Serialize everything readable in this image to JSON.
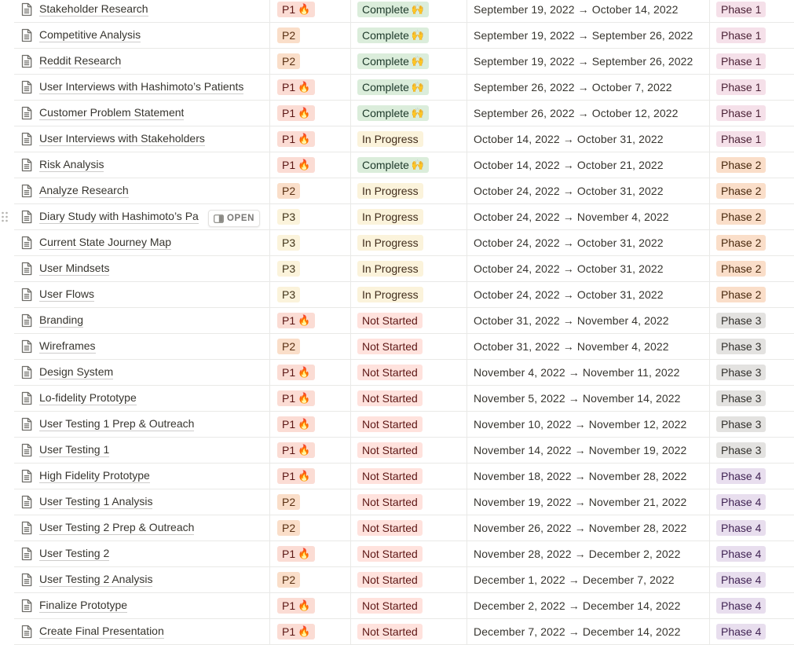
{
  "colors": {
    "p1": "#fbdcd4",
    "p1_text": "#5d1715",
    "p2": "#fadec9",
    "p2_text": "#5b3113",
    "p3": "#fbf3db",
    "p3_text": "#42351a",
    "complete": "#dbeddb",
    "complete_text": "#1c3829",
    "in_progress": "#fbf3db",
    "in_progress_text": "#402c1b",
    "not_started": "#ffe2dd",
    "not_started_text": "#5d1715",
    "phase_1": "#f5e0e9",
    "phase_1_text": "#4c2337",
    "phase_2": "#fadec9",
    "phase_2_text": "#49290e",
    "phase_3": "#e3e2e0",
    "phase_3_text": "#32302c",
    "phase_4": "#e8deee",
    "phase_4_text": "#412454"
  },
  "open_button": {
    "label": "OPEN",
    "row_index": 8,
    "icon": "sidepeek-icon"
  },
  "rows": [
    {
      "name": "Stakeholder Research",
      "priority": "P1",
      "priority_emoji": "🔥",
      "status": "Complete",
      "status_emoji": "🙌",
      "dates": "September 19, 2022 → October 14, 2022",
      "phase": "Phase 1"
    },
    {
      "name": "Competitive Analysis",
      "priority": "P2",
      "priority_emoji": "",
      "status": "Complete",
      "status_emoji": "🙌",
      "dates": "September 19, 2022 → September 26, 2022",
      "phase": "Phase 1"
    },
    {
      "name": "Reddit Research",
      "priority": "P2",
      "priority_emoji": "",
      "status": "Complete",
      "status_emoji": "🙌",
      "dates": "September 19, 2022 → September 26, 2022",
      "phase": "Phase 1"
    },
    {
      "name": "User Interviews with Hashimoto’s Patients",
      "priority": "P1",
      "priority_emoji": "🔥",
      "status": "Complete",
      "status_emoji": "🙌",
      "dates": "September 26, 2022 → October 7, 2022",
      "phase": "Phase 1"
    },
    {
      "name": "Customer Problem Statement",
      "priority": "P1",
      "priority_emoji": "🔥",
      "status": "Complete",
      "status_emoji": "🙌",
      "dates": "September 26, 2022 → October 12, 2022",
      "phase": "Phase 1"
    },
    {
      "name": "User Interviews with Stakeholders",
      "priority": "P1",
      "priority_emoji": "🔥",
      "status": "In Progress",
      "status_emoji": "",
      "dates": "October 14, 2022 → October 31, 2022",
      "phase": "Phase 1"
    },
    {
      "name": "Risk Analysis",
      "priority": "P1",
      "priority_emoji": "🔥",
      "status": "Complete",
      "status_emoji": "🙌",
      "dates": "October 14, 2022 → October 21, 2022",
      "phase": "Phase 2"
    },
    {
      "name": "Analyze Research",
      "priority": "P2",
      "priority_emoji": "",
      "status": "In Progress",
      "status_emoji": "",
      "dates": "October 24, 2022 → October 31, 2022",
      "phase": "Phase 2"
    },
    {
      "name": "Diary Study with Hashimoto’s Pa",
      "priority": "P3",
      "priority_emoji": "",
      "status": "In Progress",
      "status_emoji": "",
      "dates": "October 24, 2022 → November 4, 2022",
      "phase": "Phase 2"
    },
    {
      "name": "Current State Journey Map",
      "priority": "P3",
      "priority_emoji": "",
      "status": "In Progress",
      "status_emoji": "",
      "dates": "October 24, 2022 → October 31, 2022",
      "phase": "Phase 2"
    },
    {
      "name": "User Mindsets",
      "priority": "P3",
      "priority_emoji": "",
      "status": "In Progress",
      "status_emoji": "",
      "dates": "October 24, 2022 → October 31, 2022",
      "phase": "Phase 2"
    },
    {
      "name": "User Flows",
      "priority": "P3",
      "priority_emoji": "",
      "status": "In Progress",
      "status_emoji": "",
      "dates": "October 24, 2022 → October 31, 2022",
      "phase": "Phase 2"
    },
    {
      "name": "Branding",
      "priority": "P1",
      "priority_emoji": "🔥",
      "status": "Not Started",
      "status_emoji": "",
      "dates": "October 31, 2022 → November 4, 2022",
      "phase": "Phase 3"
    },
    {
      "name": "Wireframes",
      "priority": "P2",
      "priority_emoji": "",
      "status": "Not Started",
      "status_emoji": "",
      "dates": "October 31, 2022 → November 4, 2022",
      "phase": "Phase 3"
    },
    {
      "name": "Design System",
      "priority": "P1",
      "priority_emoji": "🔥",
      "status": "Not Started",
      "status_emoji": "",
      "dates": "November 4, 2022 → November 11, 2022",
      "phase": "Phase 3"
    },
    {
      "name": "Lo-fidelity Prototype",
      "priority": "P1",
      "priority_emoji": "🔥",
      "status": "Not Started",
      "status_emoji": "",
      "dates": "November 5, 2022 → November 14, 2022",
      "phase": "Phase 3"
    },
    {
      "name": "User Testing 1 Prep & Outreach",
      "priority": "P1",
      "priority_emoji": "🔥",
      "status": "Not Started",
      "status_emoji": "",
      "dates": "November 10, 2022 → November 12, 2022",
      "phase": "Phase 3"
    },
    {
      "name": "User Testing 1",
      "priority": "P1",
      "priority_emoji": "🔥",
      "status": "Not Started",
      "status_emoji": "",
      "dates": "November 14, 2022 → November 19, 2022",
      "phase": "Phase 3"
    },
    {
      "name": "High Fidelity Prototype",
      "priority": "P1",
      "priority_emoji": "🔥",
      "status": "Not Started",
      "status_emoji": "",
      "dates": "November 18, 2022 → November 28, 2022",
      "phase": "Phase 4"
    },
    {
      "name": "User Testing 1 Analysis",
      "priority": "P2",
      "priority_emoji": "",
      "status": "Not Started",
      "status_emoji": "",
      "dates": "November 19, 2022 → November 21, 2022",
      "phase": "Phase 4"
    },
    {
      "name": "User Testing 2 Prep & Outreach",
      "priority": "P2",
      "priority_emoji": "",
      "status": "Not Started",
      "status_emoji": "",
      "dates": "November 26, 2022 → November 28, 2022",
      "phase": "Phase 4"
    },
    {
      "name": "User Testing 2",
      "priority": "P1",
      "priority_emoji": "🔥",
      "status": "Not Started",
      "status_emoji": "",
      "dates": "November 28, 2022 → December 2, 2022",
      "phase": "Phase 4"
    },
    {
      "name": "User Testing 2 Analysis",
      "priority": "P2",
      "priority_emoji": "",
      "status": "Not Started",
      "status_emoji": "",
      "dates": "December 1, 2022 → December 7, 2022",
      "phase": "Phase 4"
    },
    {
      "name": "Finalize Prototype",
      "priority": "P1",
      "priority_emoji": "🔥",
      "status": "Not Started",
      "status_emoji": "",
      "dates": "December 2, 2022 → December 14, 2022",
      "phase": "Phase 4"
    },
    {
      "name": "Create Final Presentation",
      "priority": "P1",
      "priority_emoji": "🔥",
      "status": "Not Started",
      "status_emoji": "",
      "dates": "December 7, 2022 → December 14, 2022",
      "phase": "Phase 4"
    }
  ]
}
